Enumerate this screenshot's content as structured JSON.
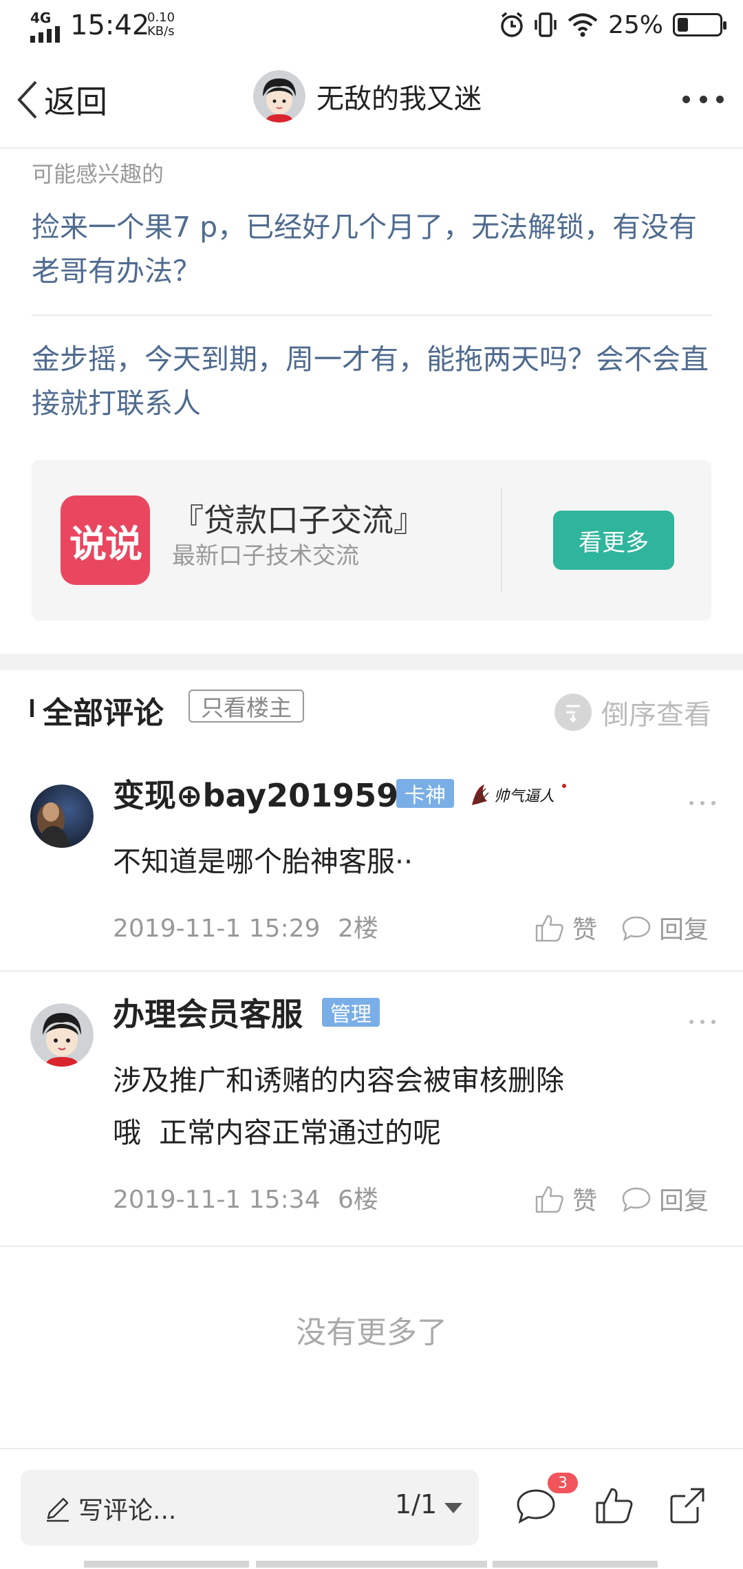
{
  "status_bar": {
    "network": "4G",
    "time": "15:42",
    "speed_value": "0.10",
    "speed_unit": "KB/s",
    "battery_percent": "25%",
    "battery_level": 0.25
  },
  "header": {
    "back_label": "返回",
    "title": "无敌的我又迷"
  },
  "interest": {
    "title": "可能感兴趣的",
    "items": [
      "捡来一个果7 p，已经好几个月了，无法解锁，有没有老哥有办法？",
      "金步摇，今天到期，周一才有，能拖两天吗？会不会直接就打联系人"
    ]
  },
  "promo": {
    "logo_text": "说说",
    "title": "『贷款口子交流』",
    "subtitle": "最新口子技术交流",
    "button": "看更多"
  },
  "comments_header": {
    "title": "全部评论",
    "only_op": "只看楼主",
    "reverse": "倒序查看"
  },
  "comments": [
    {
      "name": "变现⊕bay201959",
      "badge": "卡神",
      "signature": "帅气逼人",
      "text": "不知道是哪个胎神客服··",
      "date": "2019-11-1 15:29",
      "floor": "2楼",
      "like": "赞",
      "reply": "回复"
    },
    {
      "name": "办理会员客服",
      "badge": "管理",
      "text_line1": "涉及推广和诱赌的内容会被审核删除",
      "text_line2": "哦  正常内容正常通过的呢",
      "date": "2019-11-1 15:34",
      "floor": "6楼",
      "like": "赞",
      "reply": "回复"
    }
  ],
  "no_more": "没有更多了",
  "bottom_bar": {
    "write_placeholder": "写评论...",
    "page": "1/1",
    "comment_count": "3"
  },
  "colors": {
    "link_blue": "#4f6b8f",
    "promo_green": "#2fb59c",
    "promo_logo_red": "#e8475f",
    "badge_blue": "#7aaee6",
    "count_red": "#f1545a"
  }
}
